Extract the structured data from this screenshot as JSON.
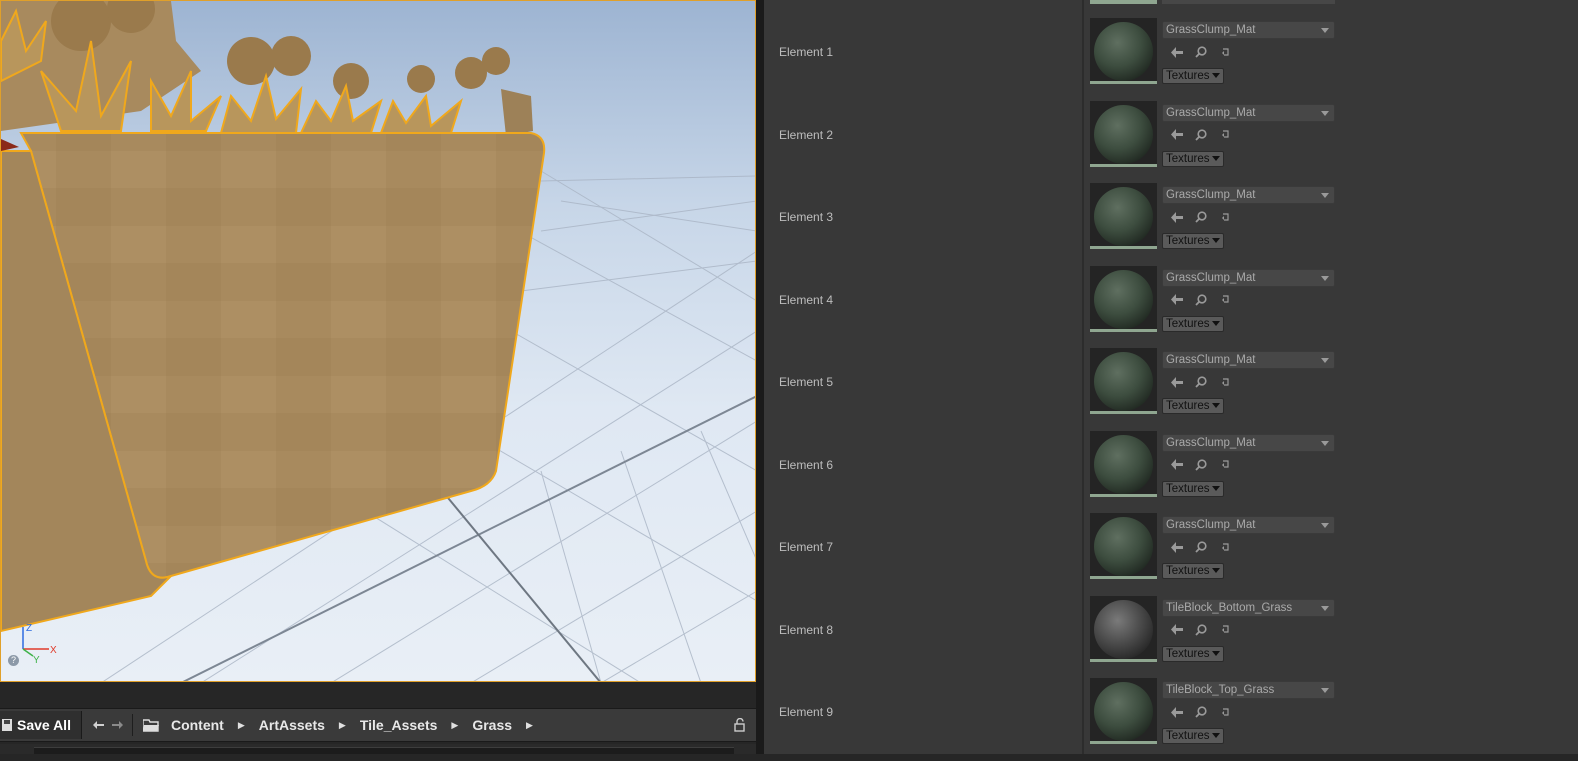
{
  "content_browser": {
    "save_all_label": "Save All",
    "breadcrumbs": [
      "Content",
      "ArtAssets",
      "Tile_Assets",
      "Grass"
    ]
  },
  "viewport": {
    "axis_labels": {
      "x": "X",
      "y": "Y",
      "z": "Z"
    },
    "help_glyph": "?"
  },
  "details": {
    "elements": [
      {
        "label": "Element 1",
        "material": "GrassClump_Mat",
        "textures_label": "Textures",
        "thumb": "grass"
      },
      {
        "label": "Element 2",
        "material": "GrassClump_Mat",
        "textures_label": "Textures",
        "thumb": "grass"
      },
      {
        "label": "Element 3",
        "material": "GrassClump_Mat",
        "textures_label": "Textures",
        "thumb": "grass"
      },
      {
        "label": "Element 4",
        "material": "GrassClump_Mat",
        "textures_label": "Textures",
        "thumb": "grass"
      },
      {
        "label": "Element 5",
        "material": "GrassClump_Mat",
        "textures_label": "Textures",
        "thumb": "grass"
      },
      {
        "label": "Element 6",
        "material": "GrassClump_Mat",
        "textures_label": "Textures",
        "thumb": "grass"
      },
      {
        "label": "Element 7",
        "material": "GrassClump_Mat",
        "textures_label": "Textures",
        "thumb": "grass"
      },
      {
        "label": "Element 8",
        "material": "TileBlock_Bottom_Grass",
        "textures_label": "Textures",
        "thumb": "dirt"
      },
      {
        "label": "Element 9",
        "material": "TileBlock_Top_Grass",
        "textures_label": "Textures",
        "thumb": "grass"
      }
    ]
  },
  "colors": {
    "selection_outline": "#f0a81c",
    "panel_bg": "#383838",
    "thumb_underline": "#8fa690"
  }
}
